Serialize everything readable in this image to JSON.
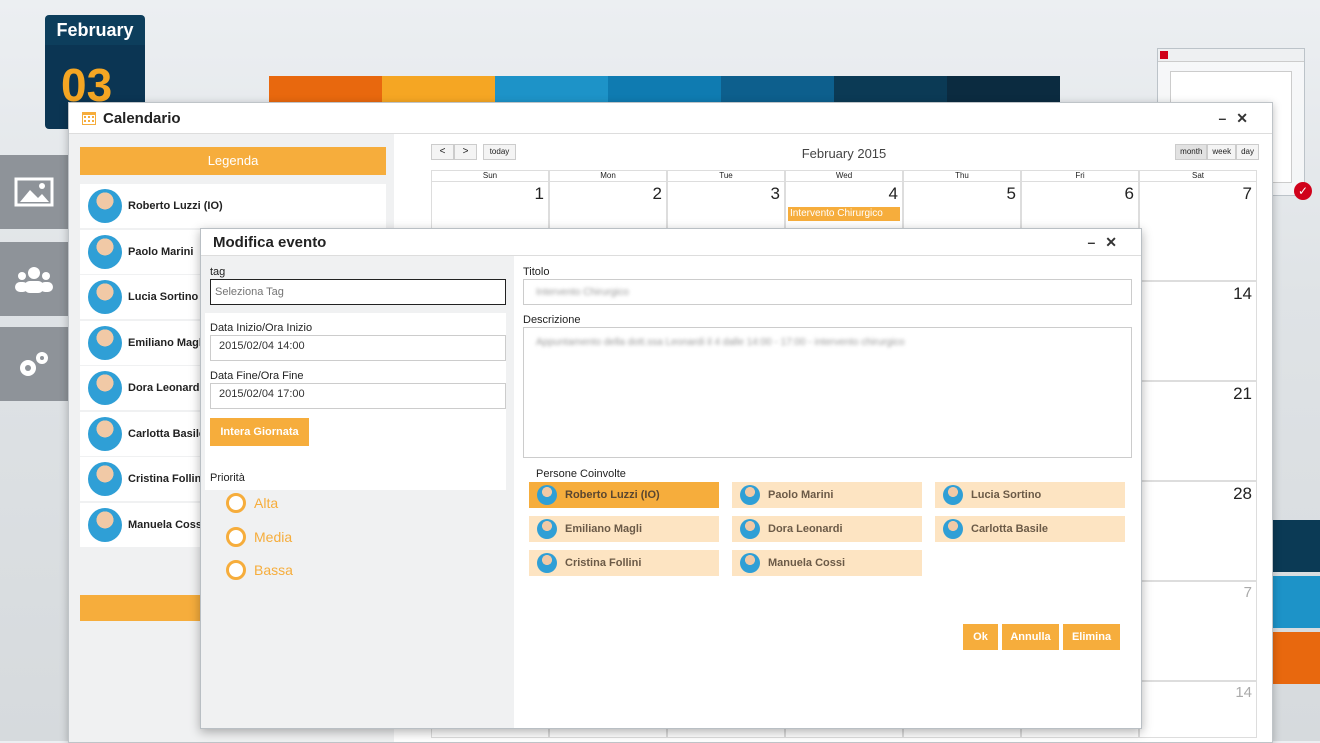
{
  "desktop": {
    "date_month": "February",
    "date_day": "03",
    "strip_colors": [
      "#e8680e",
      "#f5a623",
      "#1d93c8",
      "#0f7bb1",
      "#0d5f8d",
      "#0b3a55",
      "#0b2b40"
    ],
    "right_block_colors": [
      "#0b3a55",
      "#1d93c8",
      "#e8680e"
    ]
  },
  "calendar": {
    "title": "Calendario",
    "legend_title": "Legenda",
    "people": [
      {
        "name": "Roberto Luzzi (IO)"
      },
      {
        "name": "Paolo Marini"
      },
      {
        "name": "Lucia Sortino"
      },
      {
        "name": "Emiliano Magli"
      },
      {
        "name": "Dora Leonardi"
      },
      {
        "name": "Carlotta Basile"
      },
      {
        "name": "Cristina Follini"
      },
      {
        "name": "Manuela Cossi"
      }
    ],
    "nav_prev": "<",
    "nav_next": ">",
    "today_label": "today",
    "month_title": "February 2015",
    "views": [
      "month",
      "week",
      "day"
    ],
    "weekdays": [
      "Sun",
      "Mon",
      "Tue",
      "Wed",
      "Thu",
      "Fri",
      "Sat"
    ],
    "week1": [
      "1",
      "2",
      "3",
      "4",
      "5",
      "6",
      "7"
    ],
    "side_days": [
      "14",
      "21",
      "28",
      "7",
      "14"
    ],
    "event_label": "Intervento Chirurgico"
  },
  "dialog": {
    "title": "Modifica evento",
    "tag_label": "tag",
    "tag_placeholder": "Seleziona Tag",
    "start_label": "Data Inizio/Ora Inizio",
    "start_value": "2015/02/04 14:00",
    "end_label": "Data Fine/Ora Fine",
    "end_value": "2015/02/04 17:00",
    "all_day_label": "Intera Giornata",
    "priority_label": "Priorità",
    "priorities": [
      "Alta",
      "Media",
      "Bassa"
    ],
    "title_label": "Titolo",
    "title_value": "Intervento Chirurgico",
    "description_label": "Descrizione",
    "description_value": "Appuntamento della dott.ssa Leonardi il 4 dalle 14:00 - 17:00 - intervento chirurgico",
    "people_label": "Persone Coinvolte",
    "people": [
      {
        "name": "Roberto Luzzi (IO)",
        "selected": true
      },
      {
        "name": "Paolo Marini",
        "selected": false
      },
      {
        "name": "Lucia Sortino",
        "selected": false
      },
      {
        "name": "Emiliano Magli",
        "selected": false
      },
      {
        "name": "Dora Leonardi",
        "selected": false
      },
      {
        "name": "Carlotta Basile",
        "selected": false
      },
      {
        "name": "Cristina Follini",
        "selected": false
      },
      {
        "name": "Manuela Cossi",
        "selected": false
      }
    ],
    "ok_label": "Ok",
    "cancel_label": "Annulla",
    "delete_label": "Elimina"
  }
}
